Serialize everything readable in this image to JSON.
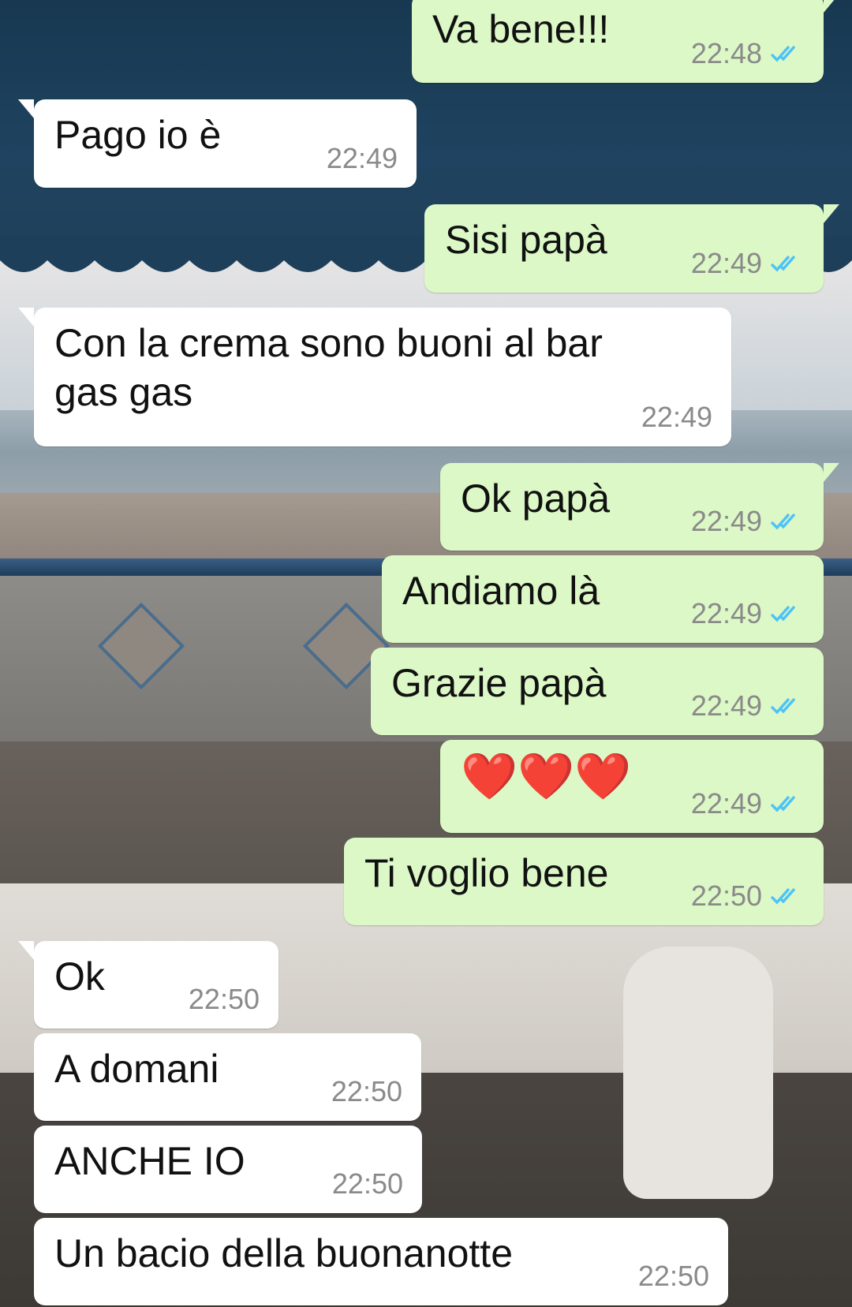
{
  "theme": {
    "incoming_bubble": "#ffffff",
    "outgoing_bubble": "#dcf8c6",
    "read_ticks_color": "#4fc3f7",
    "timestamp_color": "#8a8a8a"
  },
  "messages": [
    {
      "direction": "out",
      "text": "Va bene!!!",
      "time": "22:48",
      "status": "read-double-check-icon"
    },
    {
      "direction": "in",
      "text": "Pago io è",
      "time": "22:49"
    },
    {
      "direction": "out",
      "text": "Sisi papà",
      "time": "22:49",
      "status": "read-double-check-icon"
    },
    {
      "direction": "in",
      "text": "Con la crema sono buoni al bar\ngas gas",
      "time": "22:49"
    },
    {
      "direction": "out",
      "text": "Ok papà",
      "time": "22:49",
      "status": "read-double-check-icon"
    },
    {
      "direction": "out",
      "text": "Andiamo là",
      "time": "22:49",
      "status": "read-double-check-icon"
    },
    {
      "direction": "out",
      "text": "Grazie papà",
      "time": "22:49",
      "status": "read-double-check-icon"
    },
    {
      "direction": "out",
      "text": "❤️❤️❤️",
      "time": "22:49",
      "status": "read-double-check-icon"
    },
    {
      "direction": "out",
      "text": "Ti voglio bene",
      "time": "22:50",
      "status": "read-double-check-icon"
    },
    {
      "direction": "in",
      "text": "Ok",
      "time": "22:50"
    },
    {
      "direction": "in",
      "text": "A domani",
      "time": "22:50"
    },
    {
      "direction": "in",
      "text": "ANCHE IO",
      "time": "22:50"
    },
    {
      "direction": "in",
      "text": "Un bacio della buonanotte",
      "time": "22:50"
    }
  ]
}
